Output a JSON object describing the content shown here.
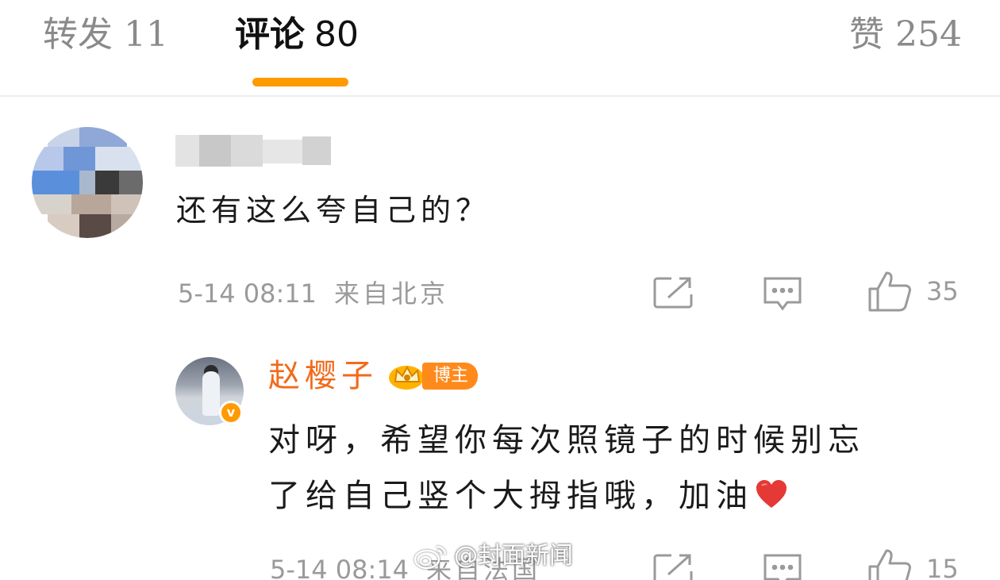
{
  "tabs": {
    "repost": {
      "label": "转发",
      "count": "11"
    },
    "comments": {
      "label": "评论",
      "count": "80"
    },
    "likes": {
      "label": "赞",
      "count": "254"
    }
  },
  "comment": {
    "text": "还有这么夸自己的？",
    "time": "5-14 08:11",
    "location": "来自北京",
    "like_count": "35"
  },
  "reply": {
    "author": "赵樱子",
    "badge": "博主",
    "line1": "对呀，希望你每次照镜子的时候别忘",
    "line2": "了给自己竖个大拇指哦，加油",
    "time": "5-14 08:14",
    "location": "来自法国",
    "like_count": "15",
    "verified": "v"
  },
  "watermark": {
    "text": "@封面新闻"
  },
  "colors": {
    "accent": "#ff9a00",
    "author": "#f26a1b",
    "meta": "#9a9a9a",
    "heart": "#e53935"
  },
  "icons": [
    "share-icon",
    "comment-icon",
    "thumbs-up-icon",
    "heart-icon",
    "crown-icon",
    "weibo-logo-icon"
  ]
}
